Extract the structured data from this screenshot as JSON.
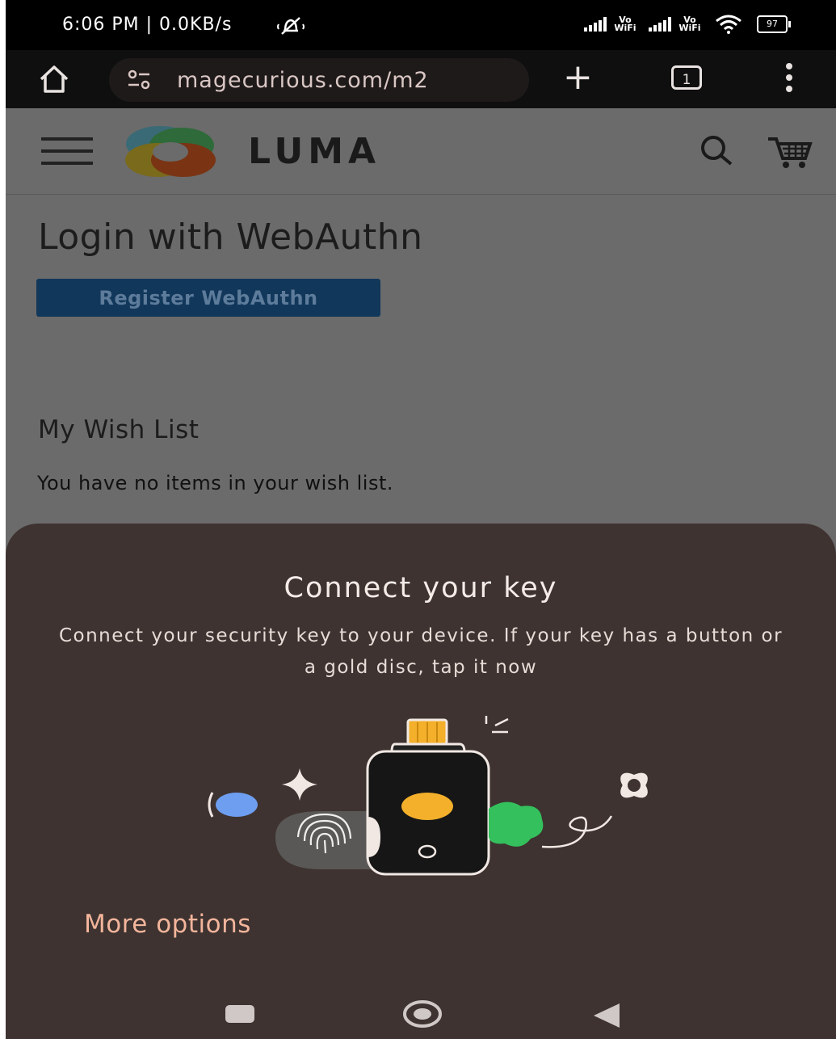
{
  "status_bar": {
    "time": "6:06 PM | 0.0KB/s",
    "wifi_calling_1": "Vo WiFi",
    "wifi_calling_2": "Vo WiFi",
    "battery": "97",
    "icons": [
      "do-not-disturb-icon",
      "signal-icon",
      "wifi-icon",
      "battery-icon"
    ]
  },
  "browser": {
    "url": "magecurious.com/m2",
    "tab_count": "1",
    "icons": [
      "home-icon",
      "site-settings-icon",
      "new-tab-icon",
      "tabs-icon",
      "menu-icon"
    ]
  },
  "site": {
    "brand": "LUMA",
    "page_title": "Login with WebAuthn",
    "register_button": "Register WebAuthn",
    "wishlist_title": "My Wish List",
    "wishlist_empty": "You have no items in your wish list."
  },
  "dialog": {
    "title": "Connect your key",
    "description": "Connect your security key to your device. If your key has a button or a gold disc, tap it now",
    "more_options": "More options"
  },
  "colors": {
    "sheet_bg": "#3e3330",
    "accent_link": "#f3b59c",
    "button_bg": "#11375a",
    "key_gold": "#f4b02b",
    "blob_green": "#34c05c",
    "dot_blue": "#6e9ef0"
  }
}
